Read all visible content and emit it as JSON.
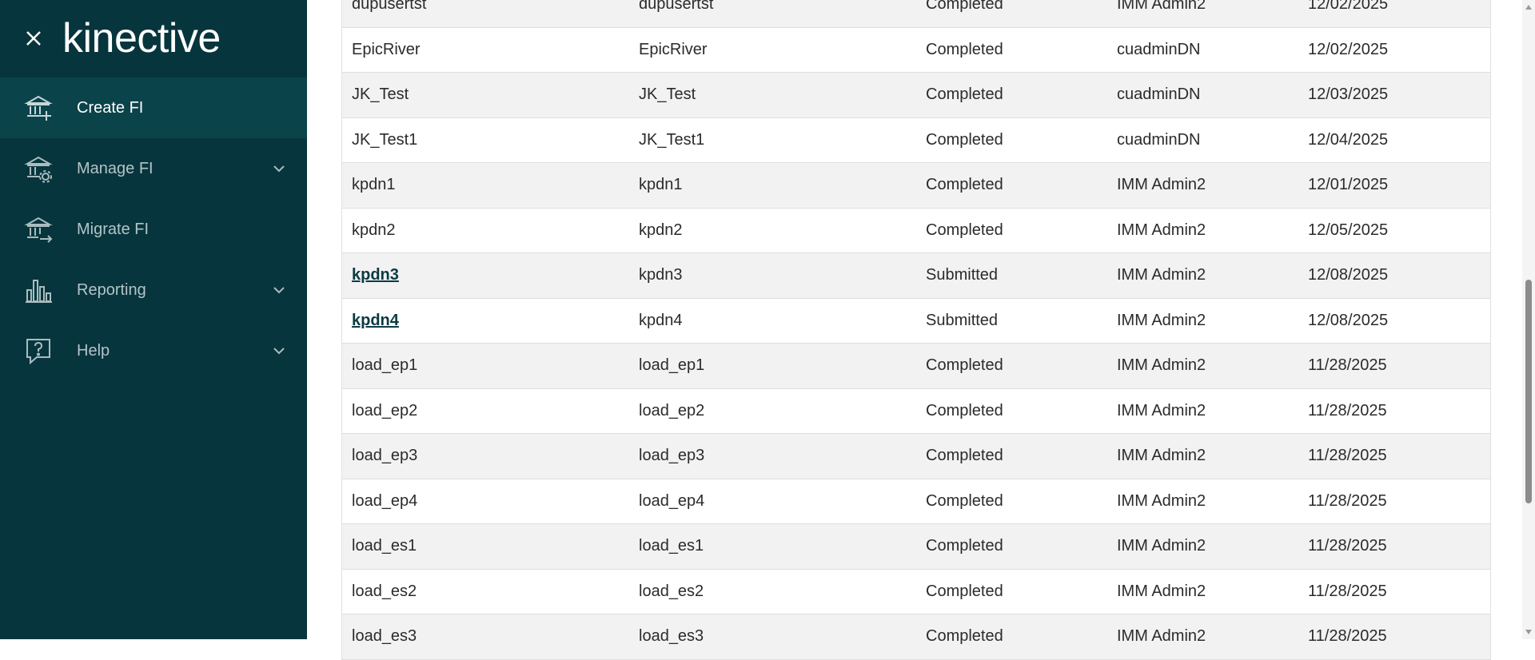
{
  "brand": {
    "logo_text": "kinective"
  },
  "nav": {
    "items": [
      {
        "label": "Create FI",
        "icon": "bank-add-icon",
        "expandable": false,
        "active": true
      },
      {
        "label": "Manage FI",
        "icon": "bank-gear-icon",
        "expandable": true,
        "active": false
      },
      {
        "label": "Migrate FI",
        "icon": "bank-migrate-icon",
        "expandable": false,
        "active": false
      },
      {
        "label": "Reporting",
        "icon": "bar-chart-icon",
        "expandable": true,
        "active": false
      },
      {
        "label": "Help",
        "icon": "help-bubble-icon",
        "expandable": true,
        "active": false
      }
    ]
  },
  "table": {
    "rows": [
      {
        "name": "dupusertst",
        "id": "dupusertst",
        "status": "Completed",
        "user": "IMM Admin2",
        "date": "12/02/2025",
        "link": false
      },
      {
        "name": "EpicRiver",
        "id": "EpicRiver",
        "status": "Completed",
        "user": "cuadminDN",
        "date": "12/02/2025",
        "link": false
      },
      {
        "name": "JK_Test",
        "id": "JK_Test",
        "status": "Completed",
        "user": "cuadminDN",
        "date": "12/03/2025",
        "link": false
      },
      {
        "name": "JK_Test1",
        "id": "JK_Test1",
        "status": "Completed",
        "user": "cuadminDN",
        "date": "12/04/2025",
        "link": false
      },
      {
        "name": "kpdn1",
        "id": "kpdn1",
        "status": "Completed",
        "user": "IMM Admin2",
        "date": "12/01/2025",
        "link": false
      },
      {
        "name": "kpdn2",
        "id": "kpdn2",
        "status": "Completed",
        "user": "IMM Admin2",
        "date": "12/05/2025",
        "link": false
      },
      {
        "name": "kpdn3",
        "id": "kpdn3",
        "status": "Submitted",
        "user": "IMM Admin2",
        "date": "12/08/2025",
        "link": true
      },
      {
        "name": "kpdn4",
        "id": "kpdn4",
        "status": "Submitted",
        "user": "IMM Admin2",
        "date": "12/08/2025",
        "link": true
      },
      {
        "name": "load_ep1",
        "id": "load_ep1",
        "status": "Completed",
        "user": "IMM Admin2",
        "date": "11/28/2025",
        "link": false
      },
      {
        "name": "load_ep2",
        "id": "load_ep2",
        "status": "Completed",
        "user": "IMM Admin2",
        "date": "11/28/2025",
        "link": false
      },
      {
        "name": "load_ep3",
        "id": "load_ep3",
        "status": "Completed",
        "user": "IMM Admin2",
        "date": "11/28/2025",
        "link": false
      },
      {
        "name": "load_ep4",
        "id": "load_ep4",
        "status": "Completed",
        "user": "IMM Admin2",
        "date": "11/28/2025",
        "link": false
      },
      {
        "name": "load_es1",
        "id": "load_es1",
        "status": "Completed",
        "user": "IMM Admin2",
        "date": "11/28/2025",
        "link": false
      },
      {
        "name": "load_es2",
        "id": "load_es2",
        "status": "Completed",
        "user": "IMM Admin2",
        "date": "11/28/2025",
        "link": false
      },
      {
        "name": "load_es3",
        "id": "load_es3",
        "status": "Completed",
        "user": "IMM Admin2",
        "date": "11/28/2025",
        "link": false
      }
    ]
  },
  "colors": {
    "sidebar": "#07353d",
    "sidebar_active": "#0b434b",
    "link": "#0b3a42"
  }
}
